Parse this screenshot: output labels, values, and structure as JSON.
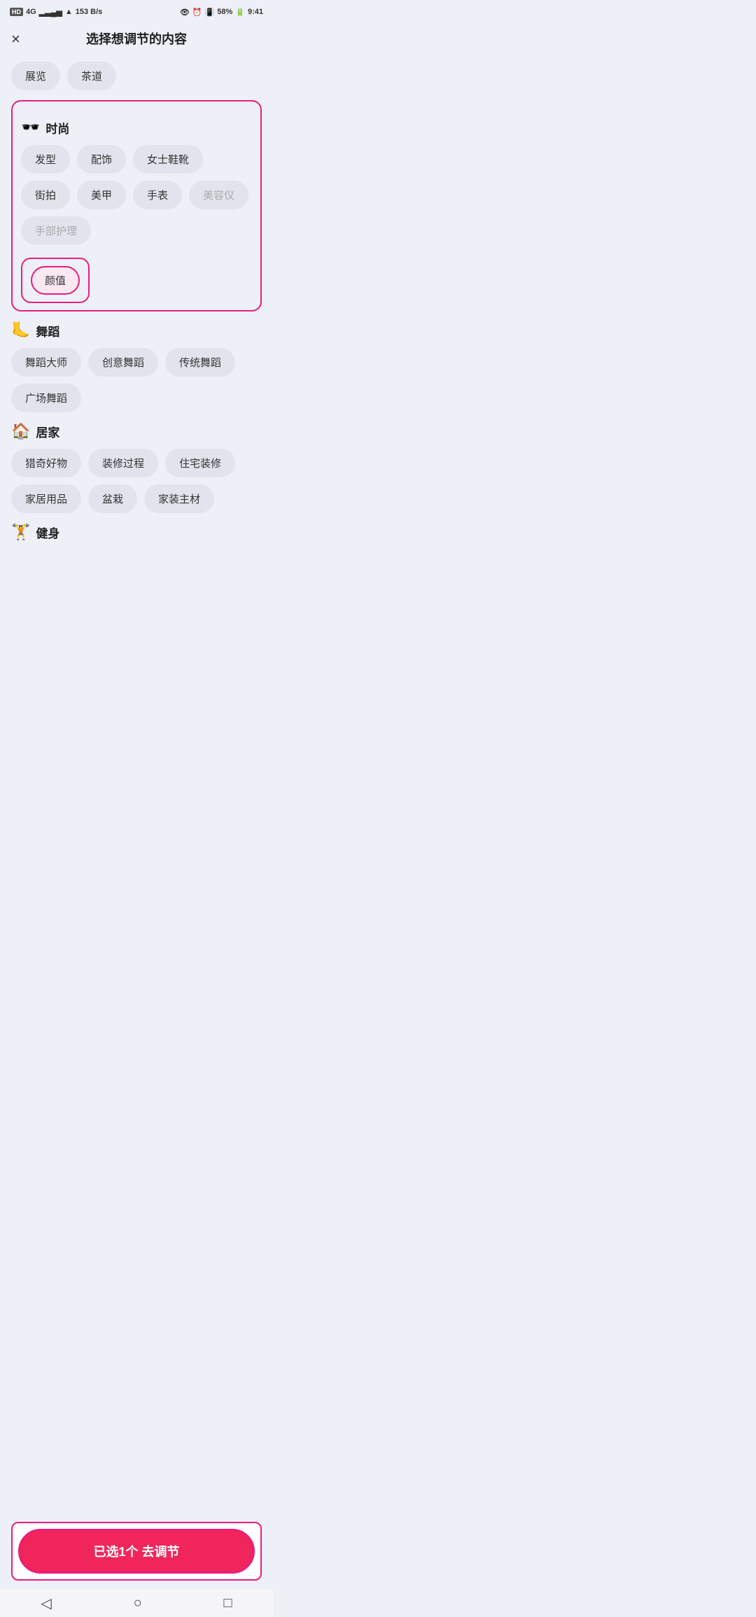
{
  "statusBar": {
    "left": {
      "hd": "HD",
      "network": "4G",
      "wifi_speed": "153 B/s"
    },
    "right": {
      "battery_pct": "58%",
      "time": "9:41"
    }
  },
  "header": {
    "close_label": "×",
    "title": "选择想调节的内容"
  },
  "topTags": [
    {
      "label": "展览",
      "selected": false,
      "disabled": false
    },
    {
      "label": "茶道",
      "selected": false,
      "disabled": false
    }
  ],
  "sections": [
    {
      "id": "fashion",
      "icon": "🕶️",
      "title": "时尚",
      "selected": true,
      "tags": [
        {
          "label": "发型",
          "selected": false,
          "disabled": false
        },
        {
          "label": "配饰",
          "selected": false,
          "disabled": false
        },
        {
          "label": "女士鞋靴",
          "selected": false,
          "disabled": false
        },
        {
          "label": "街拍",
          "selected": false,
          "disabled": false
        },
        {
          "label": "美甲",
          "selected": false,
          "disabled": false
        },
        {
          "label": "手表",
          "selected": false,
          "disabled": false
        },
        {
          "label": "美容仪",
          "selected": false,
          "disabled": true
        },
        {
          "label": "手部护理",
          "selected": false,
          "disabled": true
        }
      ],
      "selectedSubItem": {
        "label": "颜值",
        "selected": true
      }
    },
    {
      "id": "dance",
      "icon": "🦶",
      "title": "舞蹈",
      "selected": false,
      "tags": [
        {
          "label": "舞蹈大师",
          "selected": false,
          "disabled": false
        },
        {
          "label": "创意舞蹈",
          "selected": false,
          "disabled": false
        },
        {
          "label": "传统舞蹈",
          "selected": false,
          "disabled": false
        },
        {
          "label": "广场舞蹈",
          "selected": false,
          "disabled": false
        }
      ]
    },
    {
      "id": "home",
      "icon": "🏠",
      "title": "居家",
      "selected": false,
      "tags": [
        {
          "label": "猎奇好物",
          "selected": false,
          "disabled": false
        },
        {
          "label": "装修过程",
          "selected": false,
          "disabled": false
        },
        {
          "label": "住宅装修",
          "selected": false,
          "disabled": false
        },
        {
          "label": "家居用品",
          "selected": false,
          "disabled": false
        },
        {
          "label": "盆栽",
          "selected": false,
          "disabled": false
        },
        {
          "label": "家装主材",
          "selected": false,
          "disabled": false
        }
      ]
    },
    {
      "id": "fitness",
      "icon": "🏋️",
      "title": "健身",
      "selected": false,
      "tags": []
    }
  ],
  "confirmBtn": {
    "label": "已选1个 去调节"
  },
  "navBar": {
    "back": "◁",
    "home": "○",
    "recent": "□"
  }
}
